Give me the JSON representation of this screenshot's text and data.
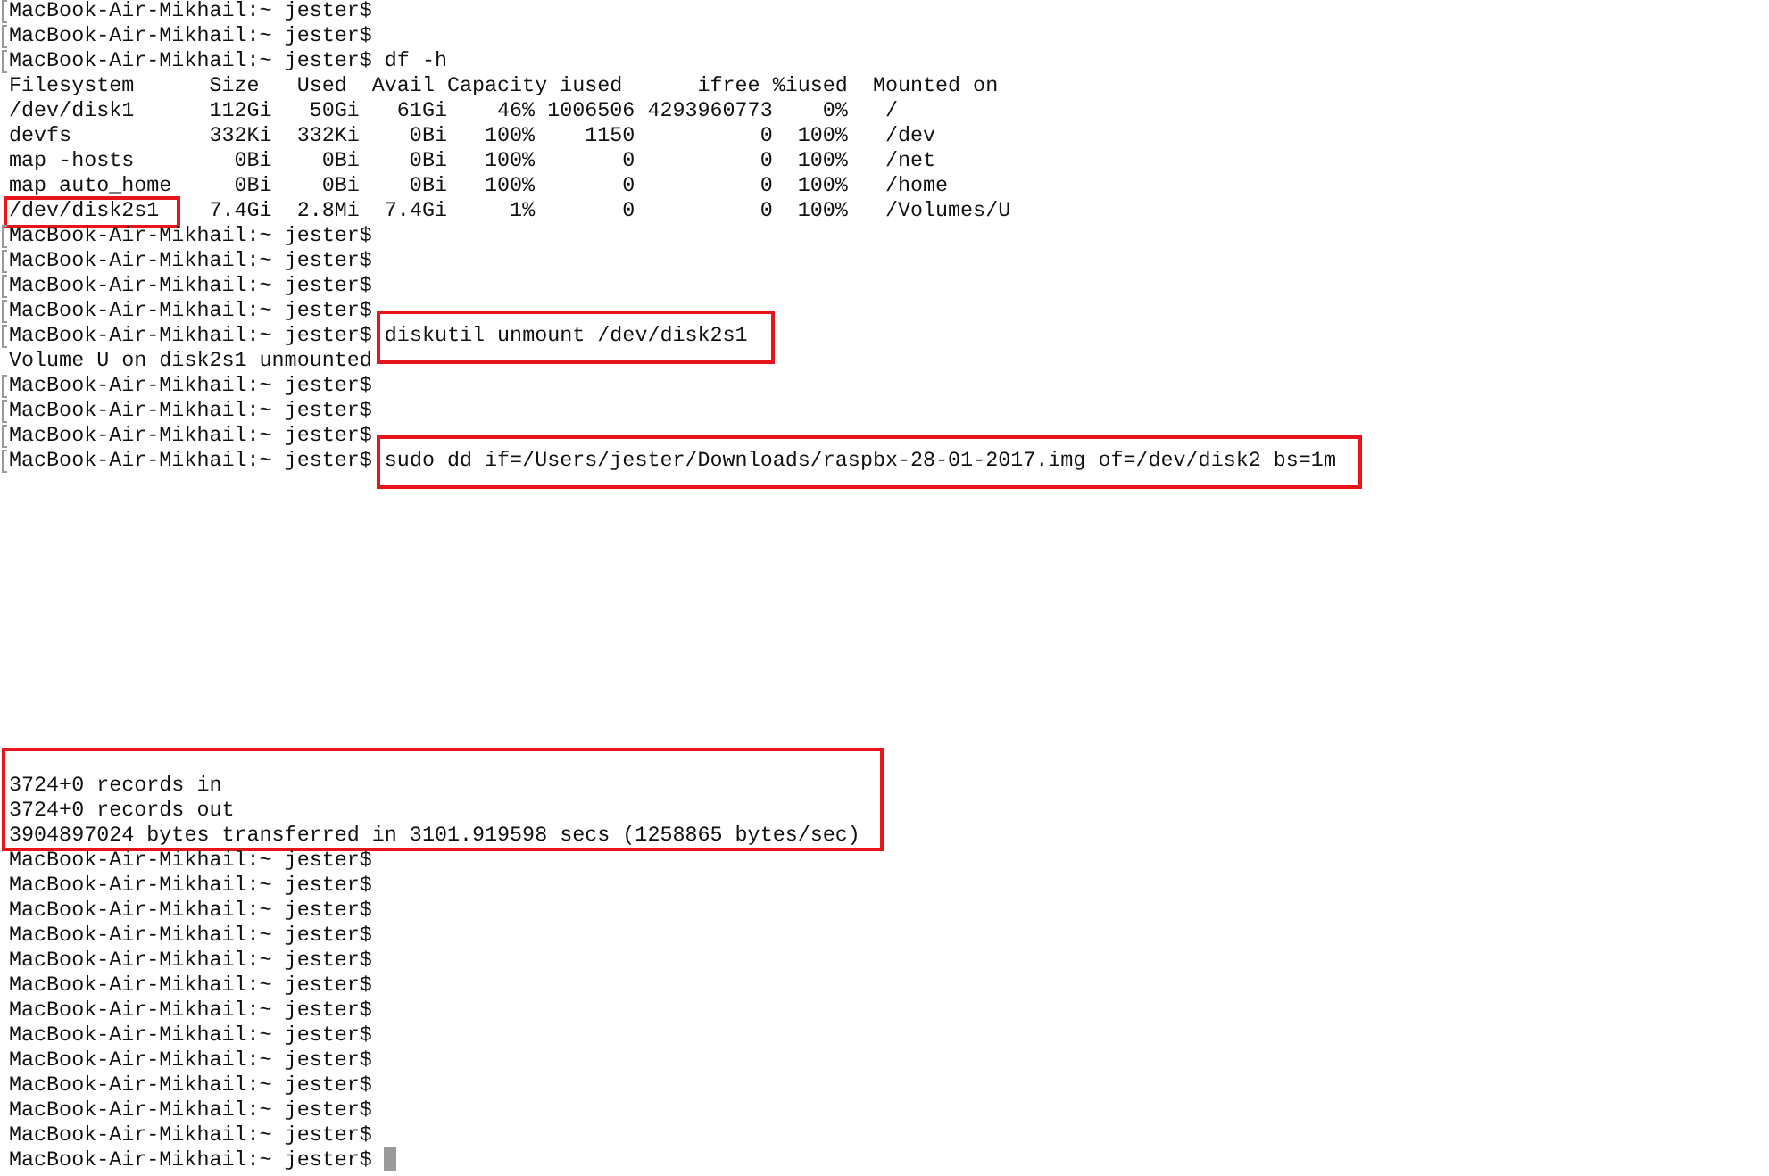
{
  "terminal": {
    "lines": [
      {
        "kind": "prompt",
        "marked": true,
        "cursor": false,
        "prompt": "MacBook-Air-Mikhail:~ jester$"
      },
      {
        "kind": "prompt",
        "marked": true,
        "cursor": false,
        "prompt": "MacBook-Air-Mikhail:~ jester$"
      },
      {
        "kind": "prompt",
        "marked": true,
        "cursor": false,
        "prompt": "MacBook-Air-Mikhail:~ jester$",
        "command": {
          "text": "df -h",
          "boxed": false
        }
      },
      {
        "kind": "output",
        "parts": [
          {
            "text": "Filesystem      Size   Used  Avail Capacity iused      ifree %iused  Mounted on",
            "boxed": false
          }
        ]
      },
      {
        "kind": "output",
        "parts": [
          {
            "text": "/dev/disk1      112Gi   50Gi   61Gi    46% 1006506 4293960773    0%   /",
            "boxed": false
          }
        ]
      },
      {
        "kind": "output",
        "parts": [
          {
            "text": "devfs           332Ki  332Ki    0Bi   100%    1150          0  100%   /dev",
            "boxed": false
          }
        ]
      },
      {
        "kind": "output",
        "parts": [
          {
            "text": "map -hosts        0Bi    0Bi    0Bi   100%       0          0  100%   /net",
            "boxed": false
          }
        ]
      },
      {
        "kind": "output",
        "parts": [
          {
            "text": "map auto_home     0Bi    0Bi    0Bi   100%       0          0  100%   /home",
            "boxed": false
          }
        ]
      },
      {
        "kind": "output",
        "parts": [
          {
            "text": "/dev/disk2s1",
            "boxed": true
          },
          {
            "text": "    7.4Gi  2.8Mi  7.4Gi     1%       0          0  100%   /Volumes/U",
            "boxed": false
          }
        ]
      },
      {
        "kind": "prompt",
        "marked": true,
        "cursor": false,
        "prompt": "MacBook-Air-Mikhail:~ jester$"
      },
      {
        "kind": "prompt",
        "marked": true,
        "cursor": false,
        "prompt": "MacBook-Air-Mikhail:~ jester$"
      },
      {
        "kind": "prompt",
        "marked": true,
        "cursor": false,
        "prompt": "MacBook-Air-Mikhail:~ jester$"
      },
      {
        "kind": "prompt",
        "marked": true,
        "cursor": false,
        "prompt": "MacBook-Air-Mikhail:~ jester$"
      },
      {
        "kind": "prompt",
        "marked": true,
        "cursor": false,
        "prompt": "MacBook-Air-Mikhail:~ jester$",
        "command": {
          "text": "diskutil unmount /dev/disk2s1",
          "boxed": true
        }
      },
      {
        "kind": "output",
        "parts": [
          {
            "text": "Volume U on disk2s1 unmounted",
            "boxed": false
          }
        ]
      },
      {
        "kind": "prompt",
        "marked": true,
        "cursor": false,
        "prompt": "MacBook-Air-Mikhail:~ jester$"
      },
      {
        "kind": "prompt",
        "marked": true,
        "cursor": false,
        "prompt": "MacBook-Air-Mikhail:~ jester$"
      },
      {
        "kind": "prompt",
        "marked": true,
        "cursor": false,
        "prompt": "MacBook-Air-Mikhail:~ jester$"
      },
      {
        "kind": "prompt",
        "marked": true,
        "cursor": false,
        "prompt": "MacBook-Air-Mikhail:~ jester$",
        "command": {
          "text": "sudo dd if=/Users/jester/Downloads/raspbx-28-01-2017.img of=/dev/disk2 bs=1m",
          "boxed": true
        }
      },
      {
        "kind": "group",
        "boxed": true,
        "lines": [
          {
            "kind": "output",
            "parts": [
              {
                "text": "3724+0 records in",
                "boxed": false
              }
            ]
          },
          {
            "kind": "output",
            "parts": [
              {
                "text": "3724+0 records out",
                "boxed": false
              }
            ]
          },
          {
            "kind": "output",
            "parts": [
              {
                "text": "3904897024 bytes transferred in 3101.919598 secs (1258865 bytes/sec)",
                "boxed": false
              }
            ]
          }
        ]
      },
      {
        "kind": "prompt",
        "marked": false,
        "cursor": false,
        "prompt": "MacBook-Air-Mikhail:~ jester$"
      },
      {
        "kind": "prompt",
        "marked": false,
        "cursor": false,
        "prompt": "MacBook-Air-Mikhail:~ jester$"
      },
      {
        "kind": "prompt",
        "marked": false,
        "cursor": false,
        "prompt": "MacBook-Air-Mikhail:~ jester$"
      },
      {
        "kind": "prompt",
        "marked": false,
        "cursor": false,
        "prompt": "MacBook-Air-Mikhail:~ jester$"
      },
      {
        "kind": "prompt",
        "marked": false,
        "cursor": false,
        "prompt": "MacBook-Air-Mikhail:~ jester$"
      },
      {
        "kind": "prompt",
        "marked": false,
        "cursor": false,
        "prompt": "MacBook-Air-Mikhail:~ jester$"
      },
      {
        "kind": "prompt",
        "marked": false,
        "cursor": false,
        "prompt": "MacBook-Air-Mikhail:~ jester$"
      },
      {
        "kind": "prompt",
        "marked": false,
        "cursor": false,
        "prompt": "MacBook-Air-Mikhail:~ jester$"
      },
      {
        "kind": "prompt",
        "marked": false,
        "cursor": false,
        "prompt": "MacBook-Air-Mikhail:~ jester$"
      },
      {
        "kind": "prompt",
        "marked": false,
        "cursor": false,
        "prompt": "MacBook-Air-Mikhail:~ jester$"
      },
      {
        "kind": "prompt",
        "marked": false,
        "cursor": false,
        "prompt": "MacBook-Air-Mikhail:~ jester$"
      },
      {
        "kind": "prompt",
        "marked": false,
        "cursor": false,
        "prompt": "MacBook-Air-Mikhail:~ jester$"
      },
      {
        "kind": "prompt",
        "marked": false,
        "cursor": true,
        "prompt": "MacBook-Air-Mikhail:~ jester$"
      }
    ]
  }
}
